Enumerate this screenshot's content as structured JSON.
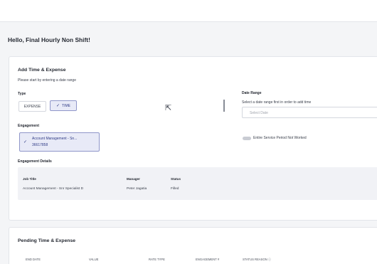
{
  "greeting": "Hello, Final Hourly Non Shift!",
  "add_card": {
    "title": "Add Time & Expense",
    "subtitle": "Please start by entering a date range",
    "type_label": "Type",
    "type_options": [
      "EXPENSE",
      "TIME"
    ],
    "selected_type": "TIME",
    "engagement_label": "Engagement",
    "engagement_name": "Account Management - Sn...",
    "engagement_number": "36617858",
    "date_range_label": "Date Range",
    "date_range_hint": "Select a date range first in order to add time",
    "date_placeholder": "Select Date",
    "toggle_label": "Entire Service Period Not Worked",
    "details_title": "Engagement Details",
    "details_headers": [
      "Job Title",
      "Manager",
      "Status"
    ],
    "details_values": [
      "Account Management - Snr Specialist D",
      "Peter Jagatia",
      "Filled"
    ]
  },
  "pending_card": {
    "title": "Pending Time & Expense",
    "columns": [
      "END DATE",
      "VALUE",
      "RATE TYPE",
      "ENGAGEMENT #",
      "STATUS REASON"
    ]
  },
  "icons": {
    "check": "check-icon",
    "cursor": "mouse-pointer-icon",
    "info": "info-icon"
  },
  "colors": {
    "accent": "#2f3a86",
    "selected_bg": "#e8eaf7",
    "page_bg": "#f4f5f7"
  }
}
